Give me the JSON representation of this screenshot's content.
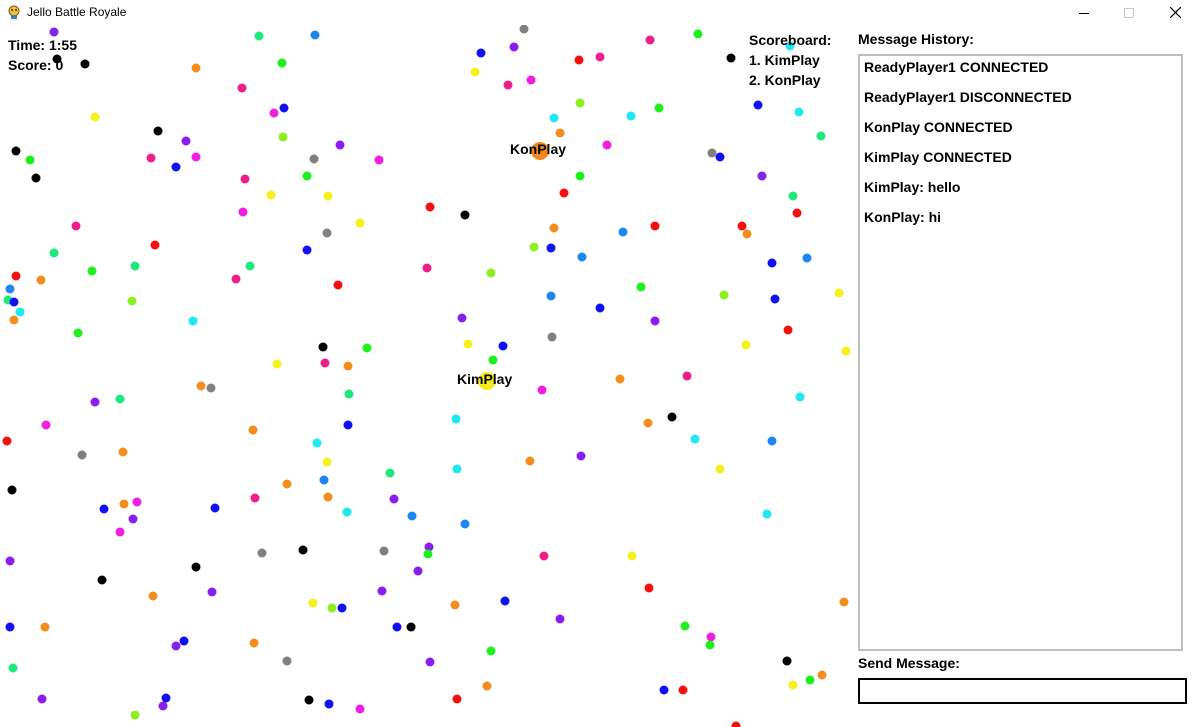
{
  "window": {
    "title": "Jello Battle Royale"
  },
  "hud": {
    "time": "Time: 1:55",
    "score": "Score: 0"
  },
  "scoreboard": {
    "title": "Scoreboard:",
    "entries": [
      "1. KimPlay",
      "2. KonPlay"
    ]
  },
  "players": [
    {
      "name": "KonPlay",
      "color": "#f08a1e"
    },
    {
      "name": "KimPlay",
      "color": "#f5ea1a"
    }
  ],
  "chat": {
    "history_label": "Message History:",
    "messages": [
      "ReadyPlayer1 CONNECTED",
      "ReadyPlayer1 DISCONNECTED",
      "KonPlay CONNECTED",
      "KimPlay CONNECTED",
      "KimPlay: hello",
      "KonPlay: hi"
    ],
    "send_label": "Send Message:",
    "input_value": ""
  },
  "palette": {
    "red": "#f51010",
    "orange": "#f58c1e",
    "yellow": "#f5f01a",
    "green": "#1ef01e",
    "spring": "#1ee87a",
    "cyan": "#1ee8f0",
    "azure": "#1e86f0",
    "blue": "#1010f0",
    "violet": "#8a1ef0",
    "magenta": "#f01ee0",
    "rose": "#f01e8a",
    "lime": "#8af01e",
    "black": "#000000",
    "gray": "#808080"
  }
}
